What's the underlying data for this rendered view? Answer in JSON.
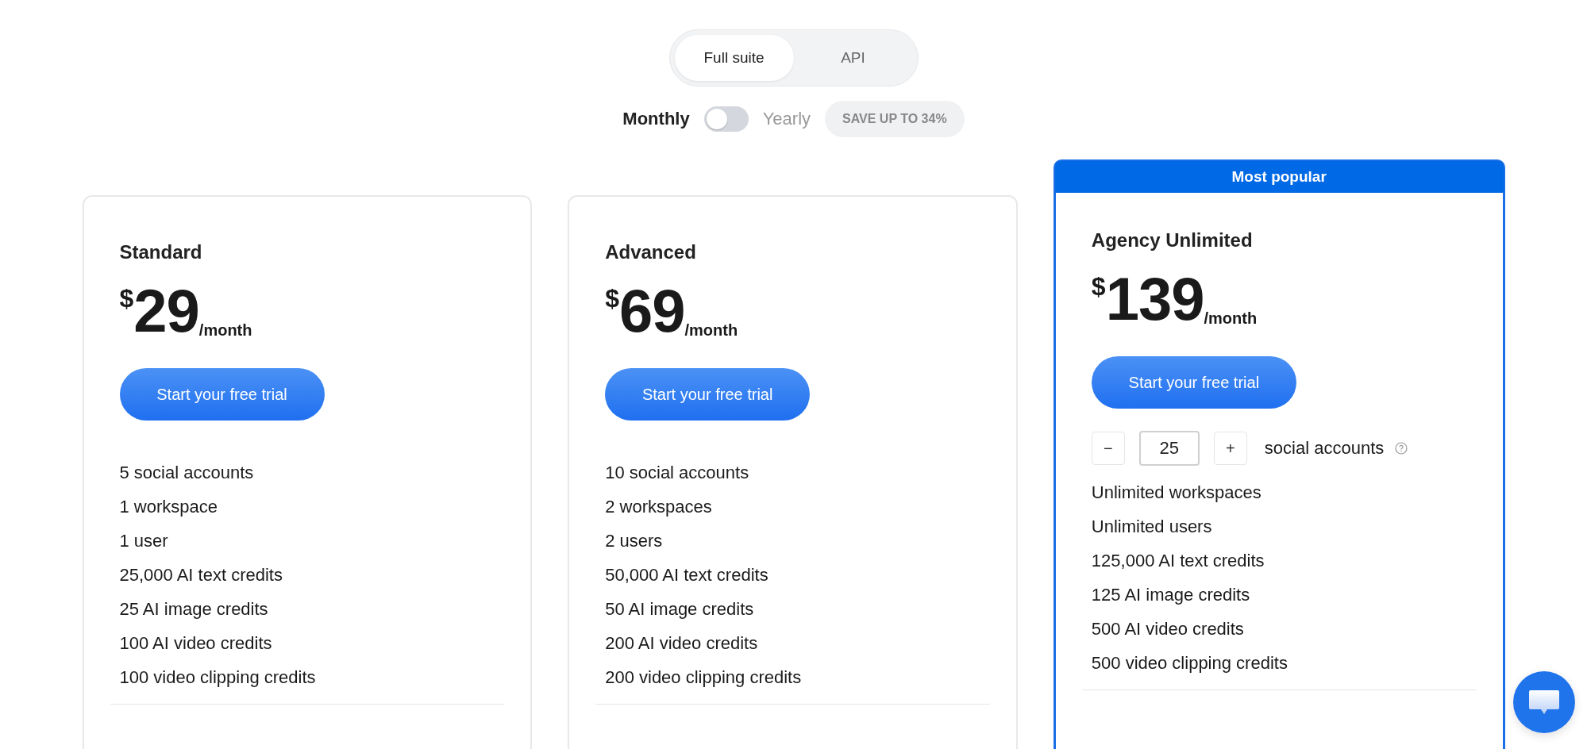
{
  "product_tabs": [
    {
      "label": "Full suite",
      "selected": true
    },
    {
      "label": "API",
      "selected": false
    }
  ],
  "billing": {
    "monthly_label": "Monthly",
    "yearly_label": "Yearly",
    "yearly": false,
    "badge": "SAVE UP TO 34%"
  },
  "plans": [
    {
      "name": "Standard",
      "currency": "$",
      "price": "29",
      "period": "/month",
      "highlighted": false,
      "button": "Start your free trial",
      "features": [
        {
          "kind": "text",
          "label": "5 social accounts"
        },
        {
          "kind": "text",
          "label": "1 workspace"
        },
        {
          "kind": "text",
          "label": "1 user"
        },
        {
          "kind": "text",
          "label": "25,000 AI text credits"
        },
        {
          "kind": "text",
          "label": "25 AI image credits"
        },
        {
          "kind": "text",
          "label": "100 AI video credits"
        },
        {
          "kind": "text",
          "label": "100 video clipping credits"
        }
      ]
    },
    {
      "name": "Advanced",
      "currency": "$",
      "price": "69",
      "period": "/month",
      "highlighted": false,
      "button": "Start your free trial",
      "features": [
        {
          "kind": "text",
          "label": "10 social accounts"
        },
        {
          "kind": "text",
          "label": "2 workspaces"
        },
        {
          "kind": "text",
          "label": "2 users"
        },
        {
          "kind": "text",
          "label": "50,000 AI text credits"
        },
        {
          "kind": "text",
          "label": "50 AI image credits"
        },
        {
          "kind": "text",
          "label": "200 AI video credits"
        },
        {
          "kind": "text",
          "label": "200 video clipping credits"
        }
      ]
    },
    {
      "name": "Agency Unlimited",
      "currency": "$",
      "price": "139",
      "period": "/month",
      "highlighted": true,
      "ribbon": "Most popular",
      "button": "Start your free trial",
      "features": [
        {
          "kind": "stepper",
          "minus": "−",
          "value": "25",
          "plus": "+",
          "label": "social accounts"
        },
        {
          "kind": "text",
          "label": "Unlimited workspaces"
        },
        {
          "kind": "text",
          "label": "Unlimited users"
        },
        {
          "kind": "text",
          "label": "125,000 AI text credits"
        },
        {
          "kind": "text",
          "label": "125 AI image credits"
        },
        {
          "kind": "text",
          "label": "500 AI video credits"
        },
        {
          "kind": "text",
          "label": "500 video clipping credits"
        }
      ]
    }
  ]
}
